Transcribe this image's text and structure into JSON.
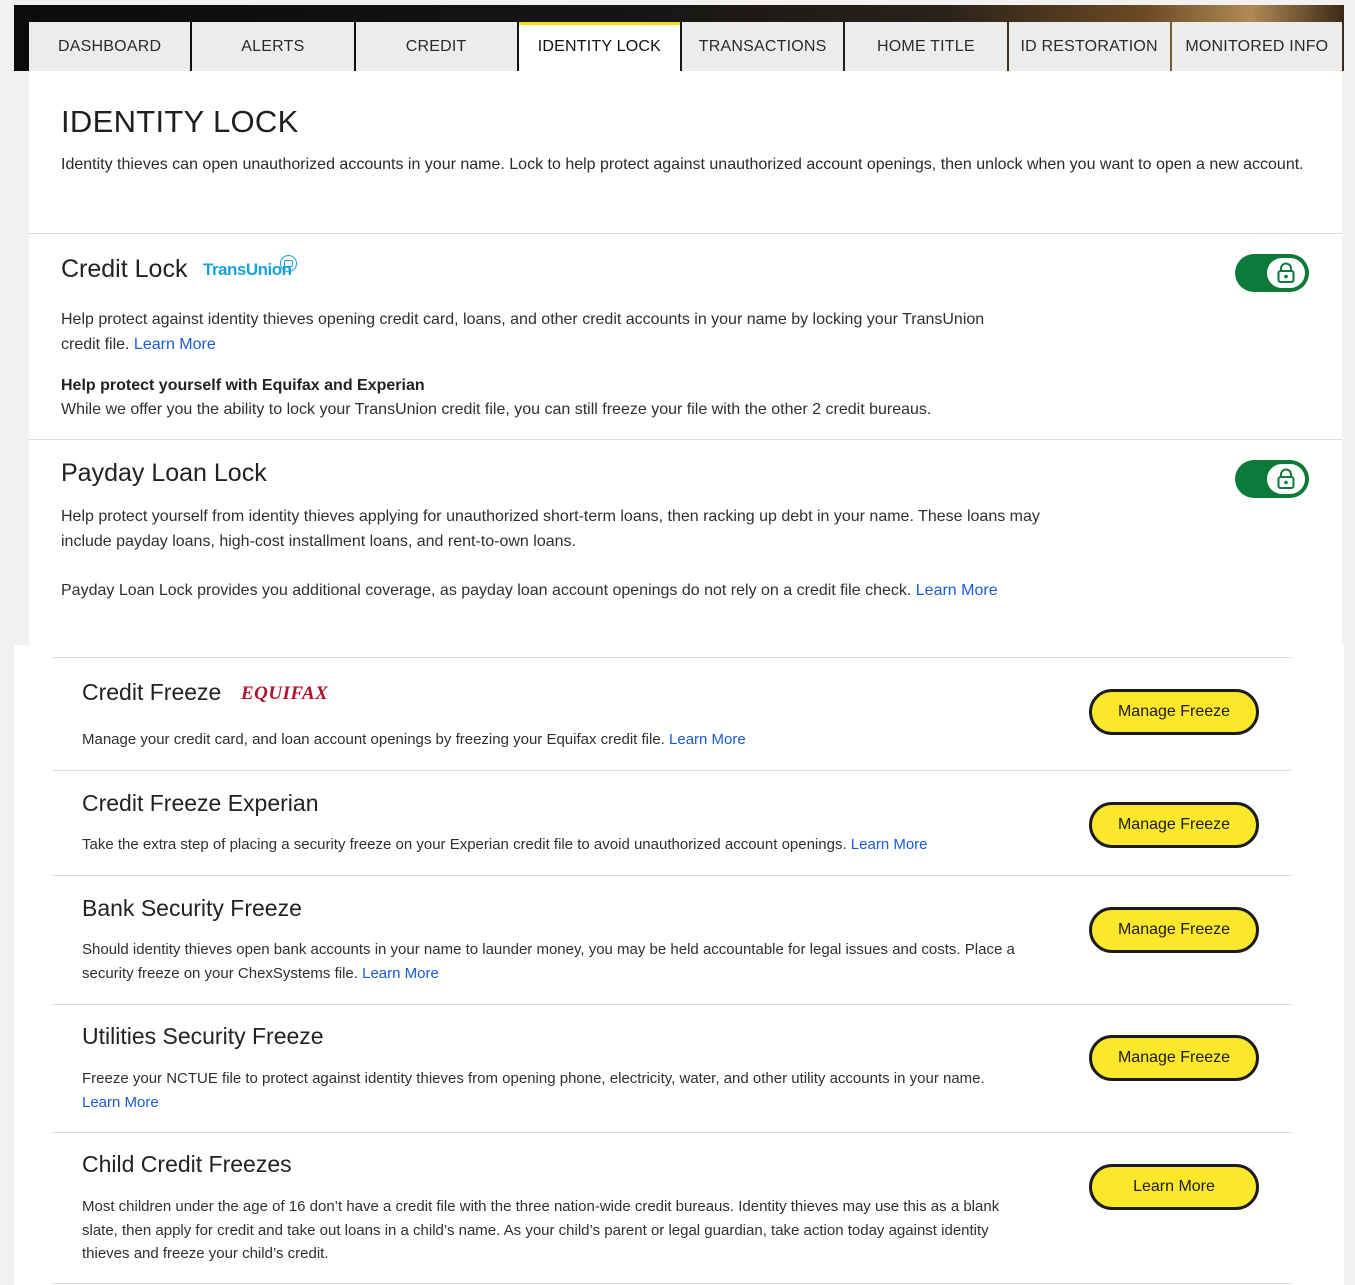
{
  "tabs": [
    {
      "label": "DASHBOARD",
      "active": false
    },
    {
      "label": "ALERTS",
      "active": false
    },
    {
      "label": "CREDIT",
      "active": false
    },
    {
      "label": "IDENTITY LOCK",
      "active": true
    },
    {
      "label": "TRANSACTIONS",
      "active": false
    },
    {
      "label": "HOME TITLE",
      "active": false
    },
    {
      "label": "ID RESTORATION",
      "active": false
    },
    {
      "label": "MONITORED INFO",
      "active": false
    }
  ],
  "page": {
    "title": "IDENTITY LOCK",
    "intro": "Identity thieves can open unauthorized accounts in your name. Lock to help protect against unauthorized account openings, then unlock when you want to open a new account."
  },
  "credit_lock": {
    "title": "Credit Lock",
    "brand": "TransUnion",
    "text": "Help protect against identity thieves opening credit card, loans, and other credit accounts in your name by locking your TransUnion credit file.",
    "link": "Learn More",
    "sub_heading": "Help protect yourself with Equifax and Experian",
    "sub_text": "While we offer you the ability to lock your TransUnion credit file, you can still freeze your file with the other 2 credit bureaus.",
    "locked": true
  },
  "payday_lock": {
    "title": "Payday Loan Lock",
    "text1": "Help protect yourself from identity thieves applying for unauthorized short-term loans, then racking up debt in your name. These loans may include payday loans, high-cost installment loans, and rent-to-own loans.",
    "text2": "Payday Loan Lock provides you additional coverage, as payday loan account openings do not rely on a credit file check.",
    "link": "Learn More",
    "locked": true
  },
  "freezes": {
    "equifax": {
      "title": "Credit Freeze",
      "brand": "EQUIFAX",
      "text": "Manage your credit card, and loan account openings by freezing your Equifax credit file.",
      "link": "Learn More",
      "button": "Manage Freeze"
    },
    "experian": {
      "title": "Credit Freeze Experian",
      "text": "Take the extra step of placing a security freeze on your Experian credit file to avoid unauthorized account openings.",
      "link": "Learn More",
      "button": "Manage Freeze"
    },
    "bank": {
      "title": "Bank Security Freeze",
      "text": "Should identity thieves open bank accounts in your name to launder money, you may be held accountable for legal issues and costs. Place a security freeze on your ChexSystems file.",
      "link": "Learn More",
      "button": "Manage Freeze"
    },
    "utilities": {
      "title": "Utilities Security Freeze",
      "text": "Freeze your NCTUE file to protect against identity thieves from opening phone, electricity, water, and other utility accounts in your name.",
      "link": "Learn More",
      "button": "Manage Freeze"
    },
    "child": {
      "title": "Child Credit Freezes",
      "text": "Most children under the age of 16 don’t have a credit file with the three nation-wide credit bureaus. Identity thieves may use this as a blank slate, then apply for credit and take out loans in a child’s name. As your child’s parent or legal guardian, take action today against identity thieves and freeze your child’s credit.",
      "button": "Learn More"
    }
  },
  "colors": {
    "toggle_on": "#0d7a3a",
    "button_bg": "#fbe82b",
    "link": "#1a5bd6",
    "active_tab_accent": "#f3dd1d"
  },
  "icons": {
    "lock": "padlock-icon"
  }
}
